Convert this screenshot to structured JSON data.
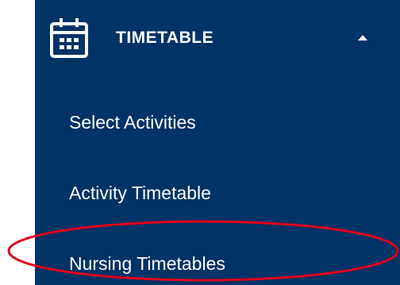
{
  "colors": {
    "sidebar_bg": "#003366",
    "text": "#FFFFFF",
    "annotation": "#E0001B"
  },
  "section": {
    "icon": "calendar-icon",
    "title": "TIMETABLE",
    "caret_icon": "caret-up-icon",
    "expanded": true
  },
  "menu": {
    "items": [
      {
        "label": "Select Activities"
      },
      {
        "label": "Activity Timetable"
      },
      {
        "label": "Nursing Timetables"
      }
    ]
  }
}
